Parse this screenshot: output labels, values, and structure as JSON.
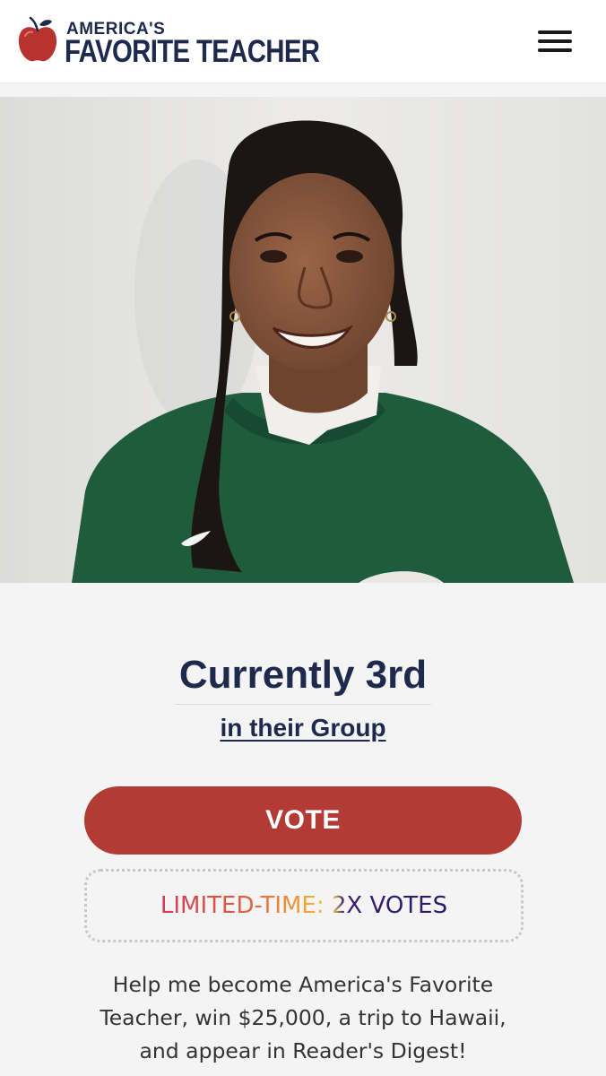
{
  "header": {
    "logo_line1": "AMERICA'S",
    "logo_line2": "FAVORITE TEACHER",
    "logo_icon": "apple-icon",
    "menu_icon": "hamburger-menu-icon"
  },
  "hero": {
    "image_alt": "Teacher portrait"
  },
  "rank": {
    "title": "Currently 3rd",
    "group_link": "in their Group"
  },
  "vote": {
    "label": "VOTE"
  },
  "promo": {
    "text": "LIMITED-TIME: 2X VOTES"
  },
  "description": {
    "text": "Help me become America's Favorite Teacher, win $25,000, a trip to Hawaii, and appear in Reader's Digest!"
  },
  "colors": {
    "brand_navy": "#1d2a4d",
    "vote_red": "#b23b36",
    "background": "#f4f4f4"
  }
}
